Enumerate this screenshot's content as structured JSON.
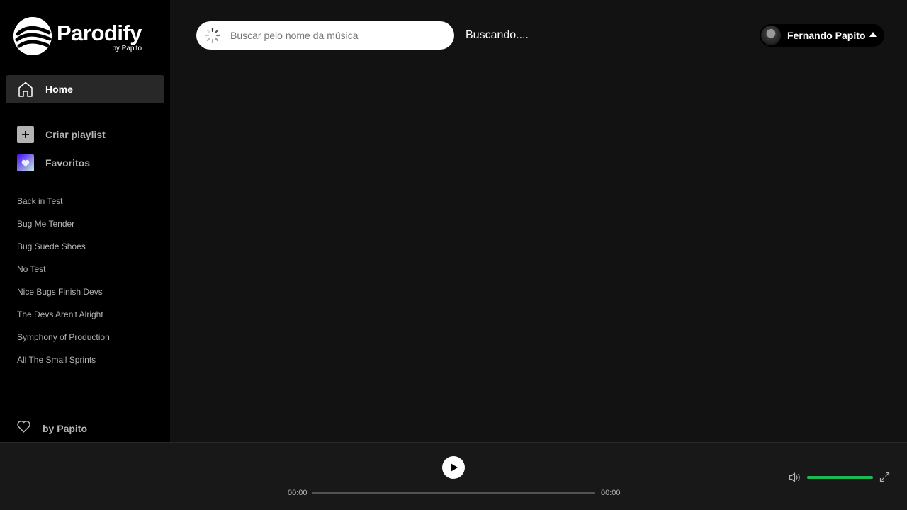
{
  "brand": {
    "title": "Parodify",
    "subtitle": "by Papito",
    "logo_icon": "sound-waves-logo-icon"
  },
  "sidebar": {
    "home": {
      "label": "Home",
      "icon": "home-icon"
    },
    "actions": [
      {
        "label": "Criar playlist",
        "icon": "plus-icon"
      },
      {
        "label": "Favoritos",
        "icon": "heart-icon"
      }
    ],
    "playlists": [
      "Back in Test",
      "Bug Me Tender",
      "Bug Suede Shoes",
      "No Test",
      "Nice Bugs Finish Devs",
      "The Devs Aren't Alright",
      "Symphony of Production",
      "All The Small Sprints"
    ],
    "footer": {
      "label": "by Papito",
      "icon": "heart-outline-icon"
    }
  },
  "search": {
    "placeholder": "Buscar pelo nome da música",
    "value": "",
    "icon": "spinner-icon"
  },
  "status": {
    "text": "Buscando...."
  },
  "user": {
    "name": "Fernando Papito",
    "icon": "caret-up-icon"
  },
  "player": {
    "current_time": "00:00",
    "total_time": "00:00",
    "progress": 0,
    "volume": 1.0,
    "play_icon": "play-icon",
    "volume_icon": "volume-icon",
    "expand_icon": "expand-icon"
  },
  "colors": {
    "accent": "#1db954",
    "sidebar_bg": "#000000",
    "main_bg": "#121212",
    "player_bg": "#181818"
  }
}
